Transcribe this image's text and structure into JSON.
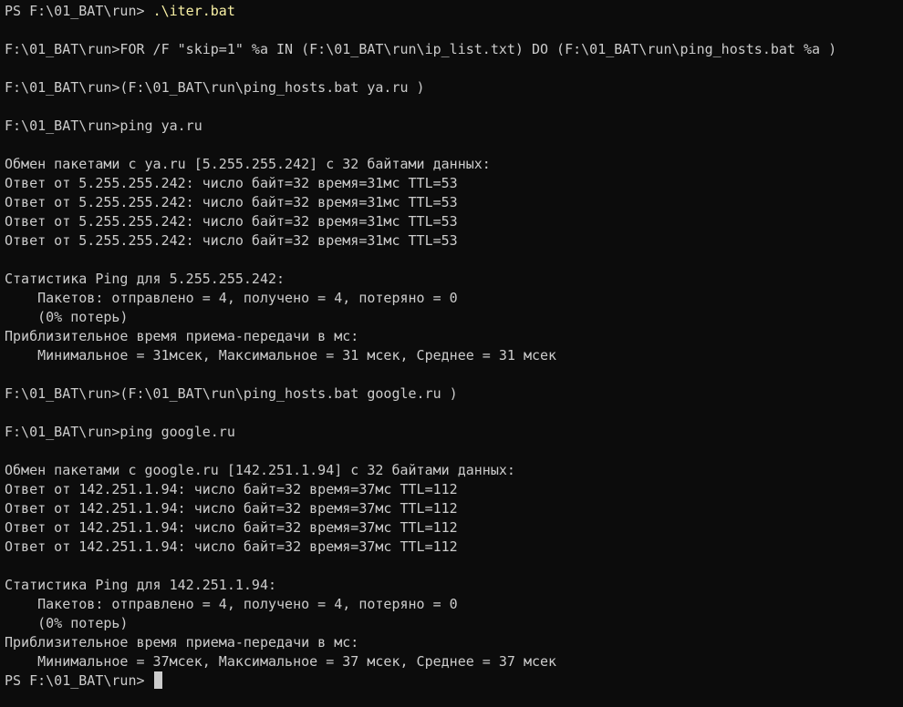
{
  "terminal": {
    "first_prompt": "PS F:\\01_BAT\\run> ",
    "first_command": ".\\iter.bat",
    "output_lines": [
      "",
      "F:\\01_BAT\\run>FOR /F \"skip=1\" %a IN (F:\\01_BAT\\run\\ip_list.txt) DO (F:\\01_BAT\\run\\ping_hosts.bat %a )",
      "",
      "F:\\01_BAT\\run>(F:\\01_BAT\\run\\ping_hosts.bat ya.ru )",
      "",
      "F:\\01_BAT\\run>ping ya.ru",
      "",
      "Обмен пакетами с ya.ru [5.255.255.242] с 32 байтами данных:",
      "Ответ от 5.255.255.242: число байт=32 время=31мс TTL=53",
      "Ответ от 5.255.255.242: число байт=32 время=31мс TTL=53",
      "Ответ от 5.255.255.242: число байт=32 время=31мс TTL=53",
      "Ответ от 5.255.255.242: число байт=32 время=31мс TTL=53",
      "",
      "Статистика Ping для 5.255.255.242:",
      "    Пакетов: отправлено = 4, получено = 4, потеряно = 0",
      "    (0% потерь)",
      "Приблизительное время приема-передачи в мс:",
      "    Минимальное = 31мсек, Максимальное = 31 мсек, Среднее = 31 мсек",
      "",
      "F:\\01_BAT\\run>(F:\\01_BAT\\run\\ping_hosts.bat google.ru )",
      "",
      "F:\\01_BAT\\run>ping google.ru",
      "",
      "Обмен пакетами с google.ru [142.251.1.94] с 32 байтами данных:",
      "Ответ от 142.251.1.94: число байт=32 время=37мс TTL=112",
      "Ответ от 142.251.1.94: число байт=32 время=37мс TTL=112",
      "Ответ от 142.251.1.94: число байт=32 время=37мс TTL=112",
      "Ответ от 142.251.1.94: число байт=32 время=37мс TTL=112",
      "",
      "Статистика Ping для 142.251.1.94:",
      "    Пакетов: отправлено = 4, получено = 4, потеряно = 0",
      "    (0% потерь)",
      "Приблизительное время приема-передачи в мс:",
      "    Минимальное = 37мсек, Максимальное = 37 мсек, Среднее = 37 мсек"
    ],
    "final_prompt": "PS F:\\01_BAT\\run> ",
    "colors": {
      "background": "#0c0c0c",
      "text": "#cccccc",
      "command": "#f9f1a5",
      "cursor": "#cccccc"
    }
  }
}
